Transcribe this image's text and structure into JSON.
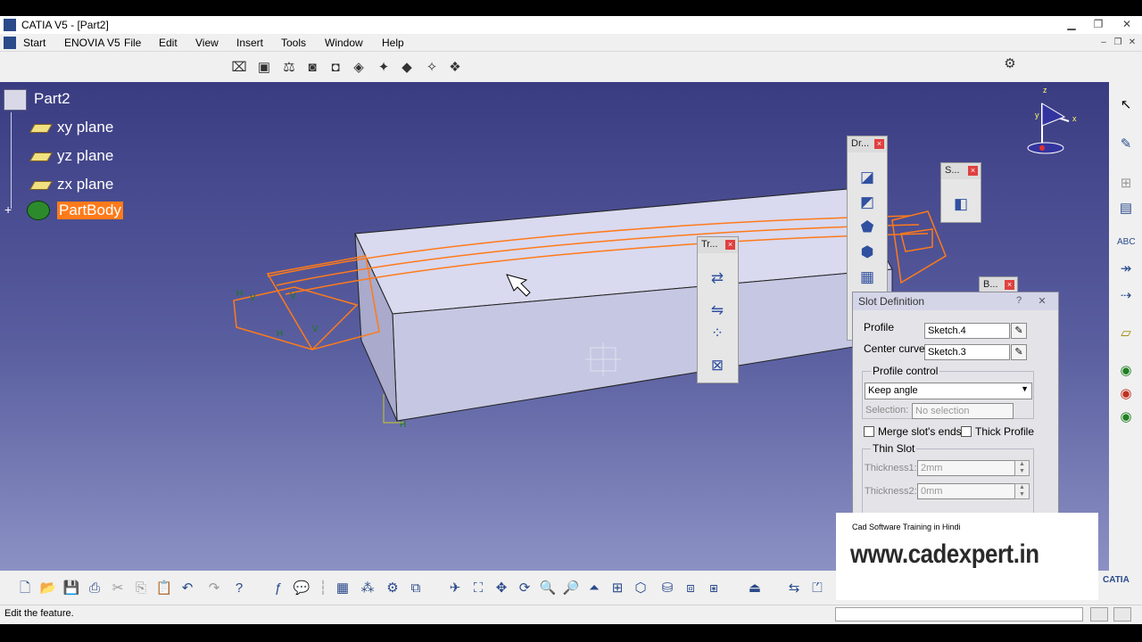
{
  "window": {
    "title": "CATIA V5 - [Part2]"
  },
  "menu": [
    "Start",
    "ENOVIA V5",
    "File",
    "Edit",
    "View",
    "Insert",
    "Tools",
    "Window",
    "Help"
  ],
  "tree": {
    "root": "Part2",
    "items": [
      "xy plane",
      "yz plane",
      "zx plane"
    ],
    "body": "PartBody"
  },
  "panels": {
    "dress_up": {
      "title": "Dr..."
    },
    "surface": {
      "title": "S..."
    },
    "transform": {
      "title": "Tr..."
    },
    "boolean": {
      "title": "B..."
    }
  },
  "slot_dialog": {
    "title": "Slot Definition",
    "profile_label": "Profile",
    "profile_value": "Sketch.4",
    "center_curve_label": "Center curve",
    "center_curve_value": "Sketch.3",
    "profile_control_label": "Profile control",
    "profile_control_value": "Keep angle",
    "selection_label": "Selection:",
    "selection_value": "No selection",
    "merge_label": "Merge slot's ends",
    "thick_label": "Thick Profile",
    "thin_slot_label": "Thin Slot",
    "thickness1_label": "Thickness1:",
    "thickness1_value": "2mm",
    "thickness2_label": "Thickness2:",
    "thickness2_value": "0mm"
  },
  "watermark": {
    "subtitle": "Cad Software Training in Hindi",
    "url": "www.cadexpert.in"
  },
  "compass": {
    "x": "x",
    "y": "y",
    "z": "z"
  },
  "brand": "CATIA",
  "status": {
    "text": "Edit the feature."
  },
  "colors": {
    "viewport_top": "#3a3c82",
    "highlight": "#ff7a1a",
    "selected_bg": "#ff7a1a"
  }
}
